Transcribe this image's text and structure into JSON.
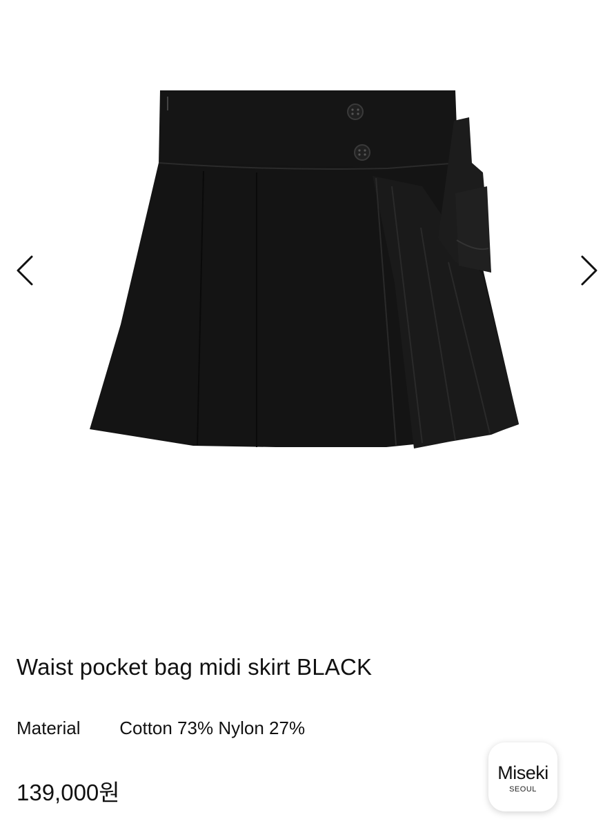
{
  "gallery": {
    "image_description_icon": "black-pleated-skirt-image",
    "prev_icon": "chevron-left-icon",
    "next_icon": "chevron-right-icon"
  },
  "product": {
    "title": "Waist pocket bag midi skirt BLACK",
    "material_label": "Material",
    "material_value": "Cotton 73% Nylon 27%",
    "price": "139,000원"
  },
  "brand": {
    "name": "Miseki",
    "subtitle": "SEOUL"
  },
  "colors": {
    "skirt": "#151515",
    "text": "#111111",
    "background": "#ffffff"
  }
}
